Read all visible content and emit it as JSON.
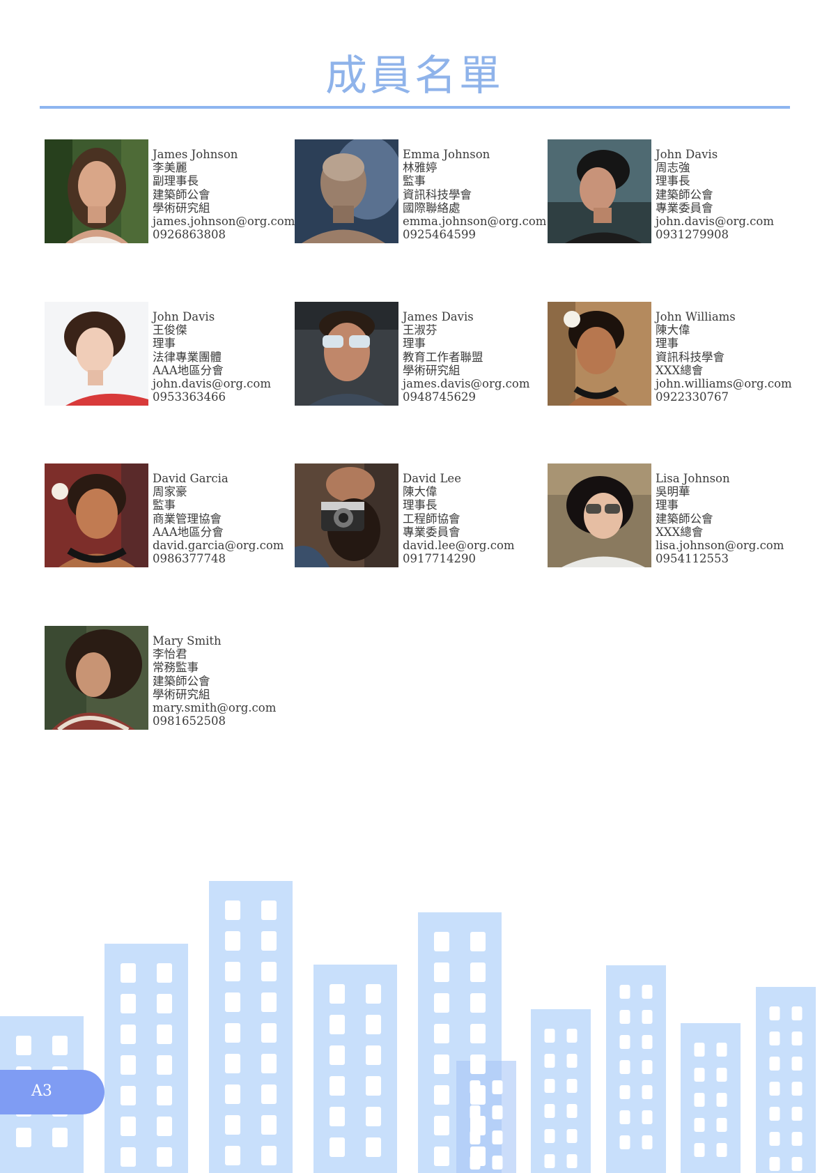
{
  "page": {
    "title": "成員名單",
    "page_label": "A3"
  },
  "colors": {
    "accent": "#8fb3ea",
    "rule": "#8db5f0",
    "building": "#c8dffb",
    "building_dark": "#a9c7f6",
    "page_tab": "#7f9cf3"
  },
  "members": [
    {
      "name": "James Johnson",
      "chinese_name": "李美麗",
      "role": "副理事長",
      "organization": "建築師公會",
      "department": "學術研究組",
      "email": "james.johnson@org.com",
      "phone": "0926863808"
    },
    {
      "name": "Emma Johnson",
      "chinese_name": "林雅婷",
      "role": "監事",
      "organization": "資訊科技學會",
      "department": "國際聯絡處",
      "email": "emma.johnson@org.com",
      "phone": "0925464599"
    },
    {
      "name": "John Davis",
      "chinese_name": "周志強",
      "role": "理事長",
      "organization": "建築師公會",
      "department": "專業委員會",
      "email": "john.davis@org.com",
      "phone": "0931279908"
    },
    {
      "name": "John Davis",
      "chinese_name": "王俊傑",
      "role": "理事",
      "organization": "法律專業團體",
      "department": "AAA地區分會",
      "email": "john.davis@org.com",
      "phone": "0953363466"
    },
    {
      "name": "James Davis",
      "chinese_name": "王淑芬",
      "role": "理事",
      "organization": "教育工作者聯盟",
      "department": "學術研究組",
      "email": "james.davis@org.com",
      "phone": "0948745629"
    },
    {
      "name": "John Williams",
      "chinese_name": "陳大偉",
      "role": "理事",
      "organization": "資訊科技學會",
      "department": "XXX總會",
      "email": "john.williams@org.com",
      "phone": "0922330767"
    },
    {
      "name": "David Garcia",
      "chinese_name": "周家豪",
      "role": "監事",
      "organization": "商業管理協會",
      "department": "AAA地區分會",
      "email": "david.garcia@org.com",
      "phone": "0986377748"
    },
    {
      "name": "David Lee",
      "chinese_name": "陳大偉",
      "role": "理事長",
      "organization": "工程師協會",
      "department": "專業委員會",
      "email": "david.lee@org.com",
      "phone": "0917714290"
    },
    {
      "name": "Lisa Johnson",
      "chinese_name": "吳明華",
      "role": "理事",
      "organization": "建築師公會",
      "department": "XXX總會",
      "email": "lisa.johnson@org.com",
      "phone": "0954112553"
    },
    {
      "name": "Mary Smith",
      "chinese_name": "李怡君",
      "role": "常務監事",
      "organization": "建築師公會",
      "department": "學術研究組",
      "email": "mary.smith@org.com",
      "phone": "0981652508"
    }
  ]
}
